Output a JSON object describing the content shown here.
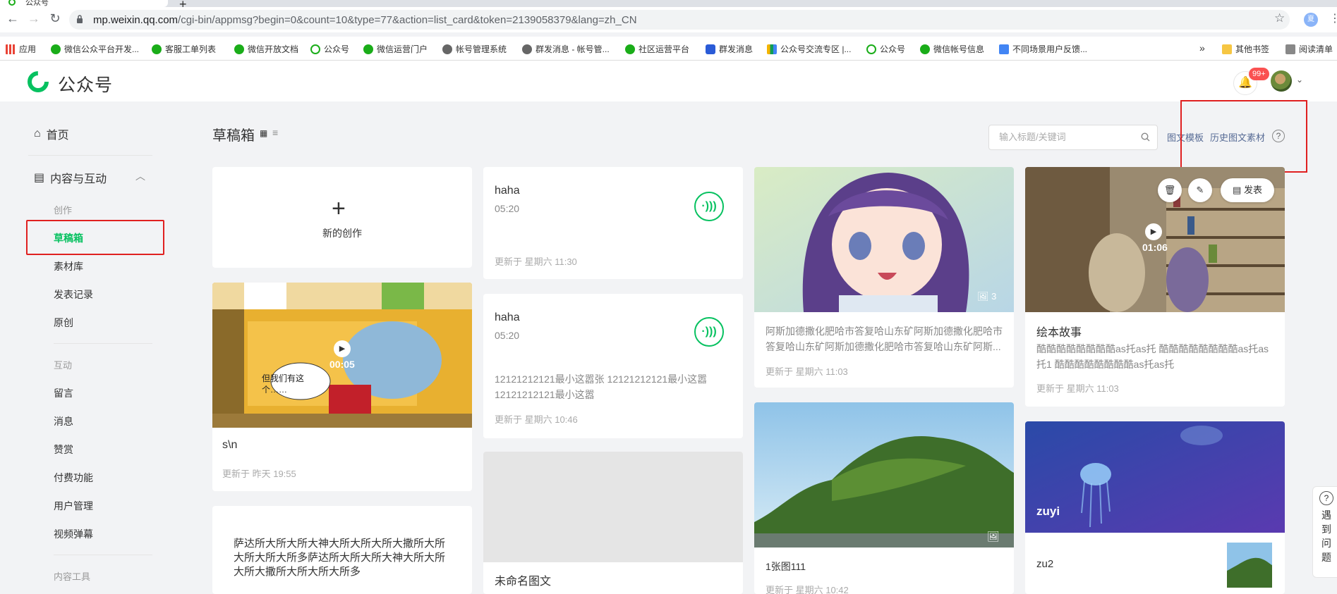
{
  "browser": {
    "tab_title": "公众号",
    "new_tab": "+",
    "url_host": "mp.weixin.qq.com",
    "url_path": "/cgi-bin/appmsg?begin=0&count=10&type=77&action=list_card&token=2139058379&lang=zh_CN",
    "profile_initial": "夏",
    "bookmarks": [
      {
        "label": "应用",
        "icon": "apps-icon"
      },
      {
        "label": "微信公众平台开发...",
        "icon": "wechat-icon"
      },
      {
        "label": "客服工单列表",
        "icon": "wechat-icon"
      },
      {
        "label": "微信开放文档",
        "icon": "wechat-icon"
      },
      {
        "label": "公众号",
        "icon": "gzh-icon"
      },
      {
        "label": "微信运营门户",
        "icon": "wechat-icon"
      },
      {
        "label": "帐号管理系统",
        "icon": "globe-icon"
      },
      {
        "label": "群发消息 - 帐号管...",
        "icon": "globe-icon"
      },
      {
        "label": "社区运营平台",
        "icon": "wechat-icon"
      },
      {
        "label": "群发消息",
        "icon": "shield-icon"
      },
      {
        "label": "公众号交流专区 |...",
        "icon": "grid-icon"
      },
      {
        "label": "公众号",
        "icon": "gzh-icon"
      },
      {
        "label": "微信帐号信息",
        "icon": "wechat-icon"
      },
      {
        "label": "不同场景用户反馈...",
        "icon": "doc-icon"
      }
    ],
    "bookmarks_more": "»",
    "other_bookmarks": "其他书签",
    "reading_list": "阅读清单"
  },
  "header": {
    "logo_text": "公众号",
    "notification_badge": "99+"
  },
  "sidebar": {
    "home": "首页",
    "content_group": "内容与互动",
    "section_create": "创作",
    "items_create": [
      "草稿箱",
      "素材库",
      "发表记录",
      "原创"
    ],
    "section_interact": "互动",
    "items_interact": [
      "留言",
      "消息",
      "赞赏",
      "付费功能",
      "用户管理",
      "视频弹幕"
    ],
    "section_tools": "内容工具"
  },
  "main": {
    "title": "草稿箱",
    "search_placeholder": "输入标题/关键词",
    "link_template": "图文模板",
    "link_history": "历史图文素材",
    "new_creation": "新的创作",
    "cards": {
      "video1": {
        "title": "s\\n",
        "duration": "00:05",
        "meta": "更新于 昨天 19:55",
        "bubble": "但我们有这个……"
      },
      "text1": {
        "text": "萨达所大所大所大神大所大所大所大撒所大所大所大所大所多萨达所大所大所大神大所大所大所大撒所大所大所大所多"
      },
      "audio1": {
        "title": "haha",
        "duration": "05:20",
        "meta": "更新于 星期六 11:30"
      },
      "audio2": {
        "title": "haha",
        "duration": "05:20",
        "desc": "12121212121最小这嚣张 12121212121最小这嚣 12121212121最小这嚣",
        "meta": "更新于 星期六 10:46"
      },
      "untitled": {
        "title": "未命名图文"
      },
      "anime": {
        "image_count": "3",
        "desc": "阿斯加德撒化肥哈市答复哈山东矿阿斯加德撒化肥哈市答复哈山东矿阿斯加德撒化肥哈市答复哈山东矿阿斯...",
        "meta": "更新于 星期六 11:03"
      },
      "island": {
        "title": "1张图111",
        "meta": "更新于 星期六 10:42"
      },
      "picturebook": {
        "duration": "01:06",
        "title": "绘本故事",
        "desc": "酷酷酷酷酷酷酷酷as托as托 酷酷酷酷酷酷酷酷as托as托1 酷酷酷酷酷酷酷酷as托as托",
        "meta": "更新于 星期六 11:03",
        "publish": "发表"
      },
      "jelly": {
        "cover_title": "zuyi",
        "sub_title": "zu2"
      }
    }
  },
  "float_help": "遇到问题",
  "colors": {
    "brand": "#07c160",
    "link": "#576b95",
    "annotation": "#e02020"
  }
}
